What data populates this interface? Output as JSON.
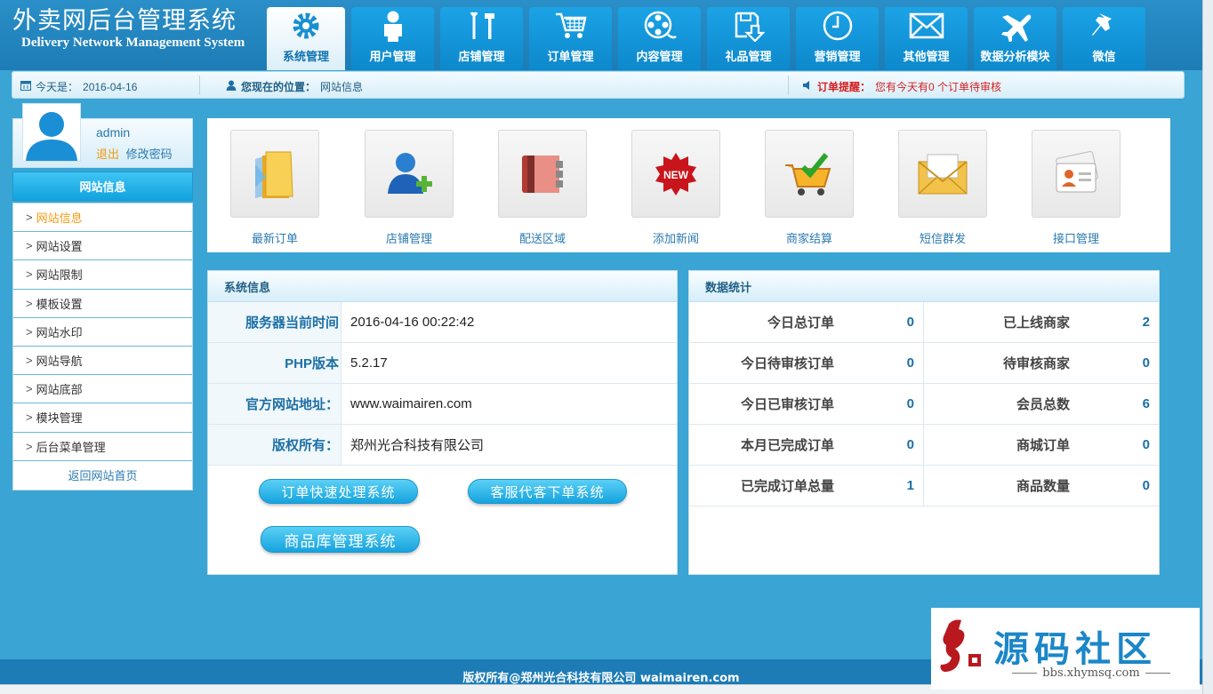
{
  "header": {
    "logo_cn": "外卖网后台管理系统",
    "logo_en": "Delivery Network Management System",
    "tabs": [
      {
        "label": "系统管理",
        "icon": "gear-icon",
        "active": true
      },
      {
        "label": "用户管理",
        "icon": "user-icon"
      },
      {
        "label": "店铺管理",
        "icon": "tools-icon"
      },
      {
        "label": "订单管理",
        "icon": "cart-icon"
      },
      {
        "label": "内容管理",
        "icon": "film-reel-icon"
      },
      {
        "label": "礼品管理",
        "icon": "floppy-download-icon"
      },
      {
        "label": "营销管理",
        "icon": "clock-icon"
      },
      {
        "label": "其他管理",
        "icon": "envelope-icon"
      },
      {
        "label": "数据分析模块",
        "icon": "airplane-icon"
      },
      {
        "label": "微信",
        "icon": "pin-icon"
      }
    ]
  },
  "infobar": {
    "today_label": "今天是：",
    "today_value": "2016-04-16",
    "location_label": "您现在的位置：",
    "location_value": "网站信息",
    "reminder_label": "订单提醒：",
    "reminder_text": "您有今天有0 个订单待审核"
  },
  "user": {
    "name": "admin",
    "logout": "退出",
    "change_password": "修改密码"
  },
  "sidebar": {
    "title": "网站信息",
    "items": [
      {
        "label": "网站信息",
        "active": true
      },
      {
        "label": "网站设置"
      },
      {
        "label": "网站限制"
      },
      {
        "label": "模板设置"
      },
      {
        "label": "网站水印"
      },
      {
        "label": "网站导航"
      },
      {
        "label": "网站底部"
      },
      {
        "label": "模块管理"
      },
      {
        "label": "后台菜单管理"
      }
    ],
    "back": "返回网站首页"
  },
  "quick": [
    {
      "label": "最新订单",
      "icon": "folder-icon"
    },
    {
      "label": "店铺管理",
      "icon": "add-user-icon"
    },
    {
      "label": "配送区域",
      "icon": "binder-icon"
    },
    {
      "label": "添加新闻",
      "icon": "new-badge-icon"
    },
    {
      "label": "商家结算",
      "icon": "cart-check-icon"
    },
    {
      "label": "短信群发",
      "icon": "mail-icon"
    },
    {
      "label": "接口管理",
      "icon": "contact-card-icon"
    }
  ],
  "system": {
    "title": "系统信息",
    "rows": [
      {
        "k": "服务器当前时间",
        "v": "2016-04-16 00:22:42"
      },
      {
        "k": "PHP版本",
        "v": "5.2.17"
      },
      {
        "k": "官方网站地址：",
        "v": "www.waimairen.com"
      },
      {
        "k": "版权所有：",
        "v": "郑州光合科技有限公司"
      }
    ],
    "buttons": [
      "订单快速处理系统",
      "客服代客下单系统",
      "商品库管理系统"
    ]
  },
  "stats": {
    "title": "数据统计",
    "rows": [
      [
        {
          "k": "今日总订单",
          "v": "0"
        },
        {
          "k": "已上线商家",
          "v": "2"
        }
      ],
      [
        {
          "k": "今日待审核订单",
          "v": "0"
        },
        {
          "k": "待审核商家",
          "v": "0"
        }
      ],
      [
        {
          "k": "今日已审核订单",
          "v": "0"
        },
        {
          "k": "会员总数",
          "v": "6"
        }
      ],
      [
        {
          "k": "本月已完成订单",
          "v": "0"
        },
        {
          "k": "商城订单",
          "v": "0"
        }
      ],
      [
        {
          "k": "已完成订单总量",
          "v": "1"
        },
        {
          "k": "商品数量",
          "v": "0"
        }
      ]
    ]
  },
  "footer": {
    "copyright": "版权所有@郑州光合科技有限公司 waimairen.com"
  },
  "watermark": {
    "seal": "小侠",
    "title": "源码社区",
    "url": "bbs.xhymsq.com"
  },
  "colors": {
    "page_bg": "#3aa5d4",
    "header_bg": "#1d7cb6",
    "accent": "#1d6fa5",
    "orange": "#f39a12",
    "alert_red": "#d62020"
  }
}
